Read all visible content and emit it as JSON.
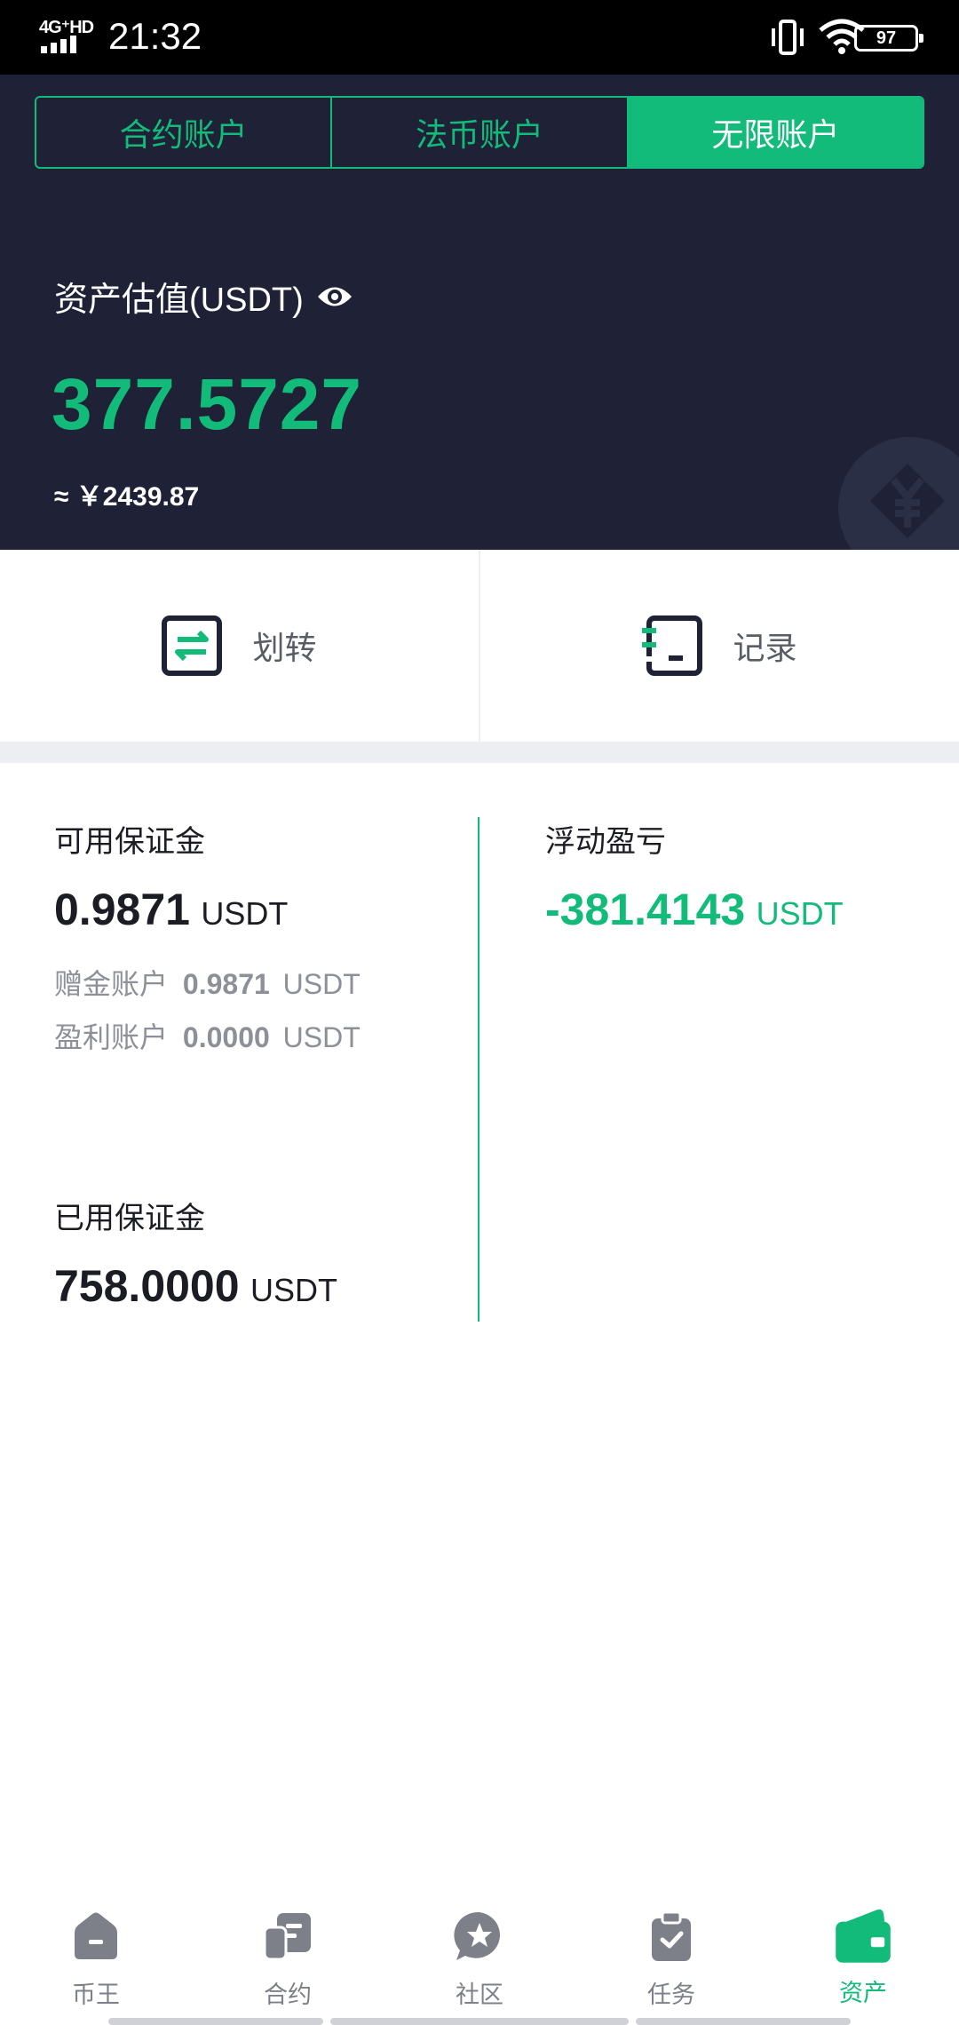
{
  "status_bar": {
    "network": "4G⁺HD",
    "time": "21:32",
    "battery": "97"
  },
  "tabs": [
    {
      "label": "合约账户",
      "active": false
    },
    {
      "label": "法币账户",
      "active": false
    },
    {
      "label": "无限账户",
      "active": true
    }
  ],
  "asset": {
    "label": "资产估值(USDT)",
    "value": "377.5727",
    "cny": "≈ ￥2439.87"
  },
  "actions": {
    "transfer": "划转",
    "records": "记录"
  },
  "available_margin": {
    "label": "可用保证金",
    "value": "0.9871",
    "unit": "USDT",
    "bonus_label": "赠金账户",
    "bonus_value": "0.9871",
    "bonus_unit": "USDT",
    "profit_label": "盈利账户",
    "profit_value": "0.0000",
    "profit_unit": "USDT"
  },
  "used_margin": {
    "label": "已用保证金",
    "value": "758.0000",
    "unit": "USDT"
  },
  "floating_pnl": {
    "label": "浮动盈亏",
    "value": "-381.4143",
    "unit": "USDT"
  },
  "bottom_nav": [
    {
      "label": "币王",
      "icon": "home-icon",
      "active": false
    },
    {
      "label": "合约",
      "icon": "contract-icon",
      "active": false
    },
    {
      "label": "社区",
      "icon": "community-icon",
      "active": false
    },
    {
      "label": "任务",
      "icon": "task-icon",
      "active": false
    },
    {
      "label": "资产",
      "icon": "wallet-icon",
      "active": true
    }
  ],
  "colors": {
    "accent": "#13bb7b",
    "header_bg": "#1f2236",
    "text_primary": "#1c1d24",
    "text_secondary": "#8d8f99"
  }
}
